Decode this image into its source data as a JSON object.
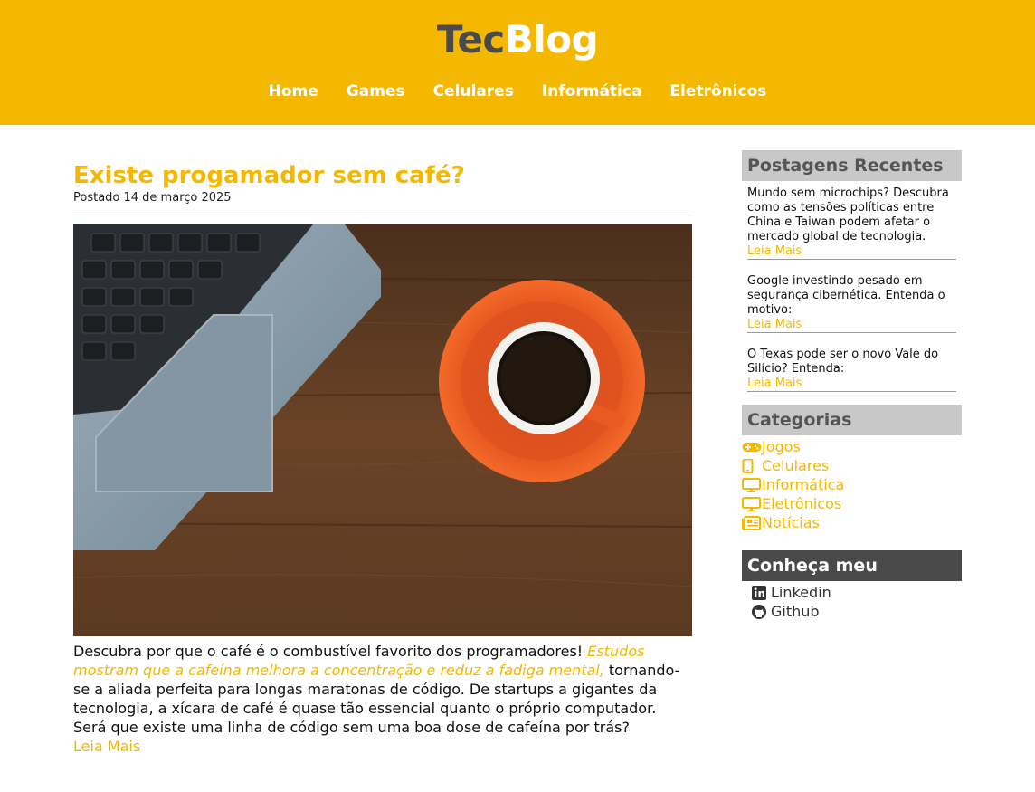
{
  "header": {
    "logo_part1": "Tec",
    "logo_part2": "Blog",
    "nav": [
      "Home",
      "Games",
      "Celulares",
      "Informática",
      "Eletrônicos"
    ]
  },
  "post": {
    "title": "Existe progamador sem café?",
    "date": "Postado 14 de março 2025",
    "text_intro": "Descubra por que o café é o combustível favorito dos programadores! ",
    "text_highlight": "Estudos mostram que a cafeína melhora a concentração e reduz a fadiga mental,",
    "text_rest": " tornando-se a aliada perfeita para longas maratonas de código. De startups a gigantes da tecnologia, a xícara de café é quase tão essencial quanto o próprio computador. Será que existe uma linha de código sem uma boa dose de cafeína por trás?",
    "read_more": "Leia Mais"
  },
  "sidebar": {
    "recent_title": "Postagens Recentes",
    "recent": [
      {
        "text": "Mundo sem microchips? Descubra como as tensões políticas entre China e Taiwan podem afetar o mercado global de tecnologia.",
        "link": "Leia Mais"
      },
      {
        "text": "Google investindo pesado em segurança cibernética. Entenda o motivo:",
        "link": "Leia Mais"
      },
      {
        "text": "O Texas pode ser o novo Vale do Silício? Entenda:",
        "link": "Leia Mais"
      }
    ],
    "categories_title": "Categorias",
    "categories": [
      {
        "label": "Jogos",
        "icon": "gamepad-icon"
      },
      {
        "label": "Celulares",
        "icon": "mobile-icon"
      },
      {
        "label": "Informática",
        "icon": "monitor-icon"
      },
      {
        "label": "Eletrônicos",
        "icon": "desktop-icon"
      },
      {
        "label": "Notícias",
        "icon": "newspaper-icon"
      }
    ],
    "work_title": "Conheça meu trabalho",
    "work": [
      {
        "label": "Linkedin",
        "icon": "linkedin-icon"
      },
      {
        "label": "Github",
        "icon": "github-icon"
      }
    ]
  },
  "colors": {
    "accent": "#f5b800",
    "logo_dark": "#4a4a4a",
    "sidebar_header": "#c8c8c8",
    "sidebar_header_dark": "#4a4a4a"
  }
}
